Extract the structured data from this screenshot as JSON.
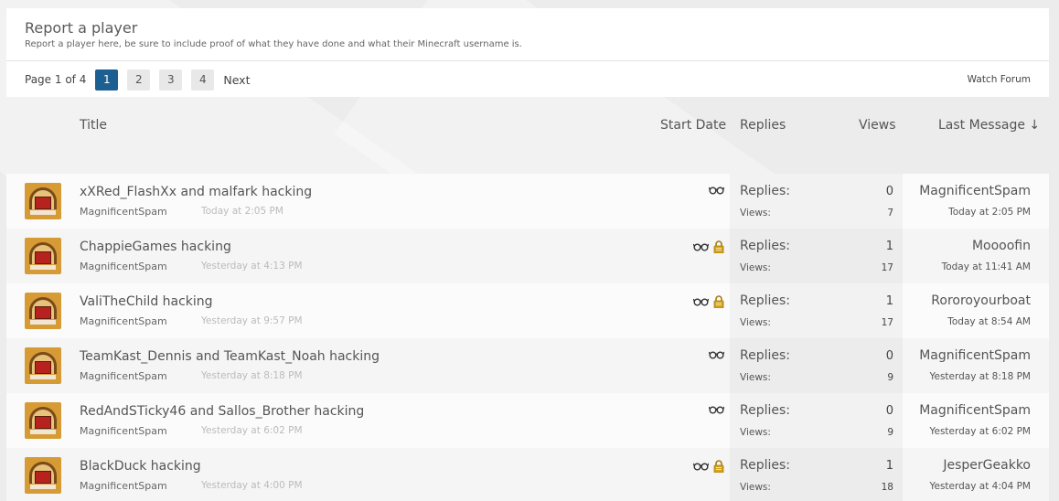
{
  "forum": {
    "title": "Report a player",
    "description": "Report a player here, be sure to include proof of what they have done and what their Minecraft username is."
  },
  "pager": {
    "info": "Page 1 of 4",
    "pages": [
      "1",
      "2",
      "3",
      "4"
    ],
    "current": "1",
    "next_label": "Next"
  },
  "watch_forum_label": "Watch Forum",
  "columns": {
    "title": "Title",
    "start_date": "Start Date",
    "replies": "Replies",
    "views": "Views",
    "last_message": "Last Message ↓"
  },
  "labels": {
    "replies": "Replies:",
    "views": "Views:"
  },
  "threads": [
    {
      "title": "xXRed_FlashXx and malfark hacking",
      "author": "MagnificentSpam",
      "date": "Today at 2:05 PM",
      "replies": "0",
      "views": "7",
      "last_user": "MagnificentSpam",
      "last_date": "Today at 2:05 PM",
      "icons": [
        "glasses-icon"
      ]
    },
    {
      "title": "ChappieGames hacking",
      "author": "MagnificentSpam",
      "date": "Yesterday at 4:13 PM",
      "replies": "1",
      "views": "17",
      "last_user": "Moooofin",
      "last_date": "Today at 11:41 AM",
      "icons": [
        "glasses-icon",
        "lock-icon"
      ]
    },
    {
      "title": "ValiTheChild hacking",
      "author": "MagnificentSpam",
      "date": "Yesterday at 9:57 PM",
      "replies": "1",
      "views": "17",
      "last_user": "Rororoyourboat",
      "last_date": "Today at 8:54 AM",
      "icons": [
        "glasses-icon",
        "lock-icon"
      ]
    },
    {
      "title": "TeamKast_Dennis and TeamKast_Noah hacking",
      "author": "MagnificentSpam",
      "date": "Yesterday at 8:18 PM",
      "replies": "0",
      "views": "9",
      "last_user": "MagnificentSpam",
      "last_date": "Yesterday at 8:18 PM",
      "icons": [
        "glasses-icon"
      ]
    },
    {
      "title": "RedAndSTicky46 and Sallos_Brother hacking",
      "author": "MagnificentSpam",
      "date": "Yesterday at 6:02 PM",
      "replies": "0",
      "views": "9",
      "last_user": "MagnificentSpam",
      "last_date": "Yesterday at 6:02 PM",
      "icons": [
        "glasses-icon"
      ]
    },
    {
      "title": "BlackDuck hacking",
      "author": "MagnificentSpam",
      "date": "Yesterday at 4:00 PM",
      "replies": "1",
      "views": "18",
      "last_user": "JesperGeakko",
      "last_date": "Yesterday at 4:04 PM",
      "icons": [
        "glasses-icon",
        "lock-icon"
      ]
    }
  ],
  "colors": {
    "active_page": "#1d5f91",
    "lock_gold": "#d4a21a"
  }
}
